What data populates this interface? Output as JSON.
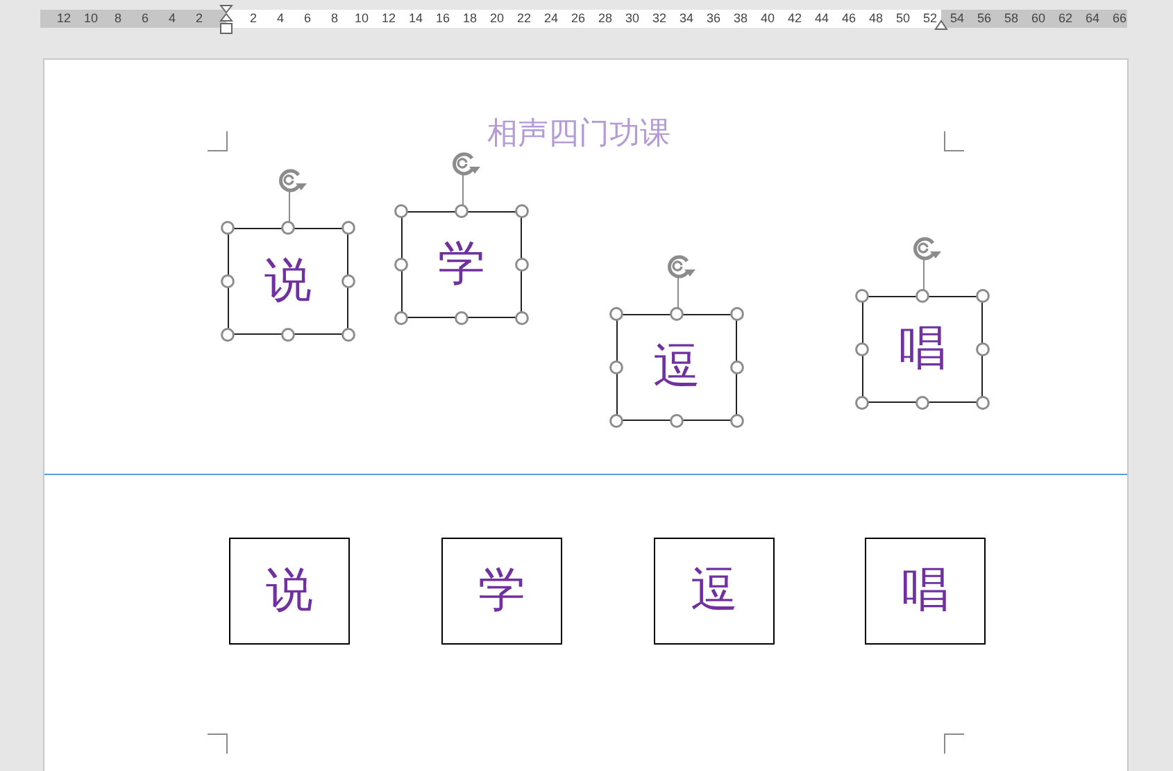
{
  "ruler": {
    "labels": [
      "12",
      "10",
      "8",
      "6",
      "4",
      "2",
      "2",
      "4",
      "6",
      "8",
      "10",
      "12",
      "14",
      "16",
      "18",
      "20",
      "22",
      "24",
      "26",
      "28",
      "30",
      "32",
      "34",
      "36",
      "38",
      "40",
      "42",
      "44",
      "46",
      "48",
      "50",
      "52",
      "54",
      "56",
      "58",
      "60",
      "62",
      "64",
      "66"
    ]
  },
  "title": "相声四门功课",
  "shapes": [
    {
      "text": "说",
      "selected": true
    },
    {
      "text": "学",
      "selected": true
    },
    {
      "text": "逗",
      "selected": true
    },
    {
      "text": "唱",
      "selected": true
    }
  ],
  "boxes": [
    {
      "text": "说"
    },
    {
      "text": "学"
    },
    {
      "text": "逗"
    },
    {
      "text": "唱"
    }
  ]
}
